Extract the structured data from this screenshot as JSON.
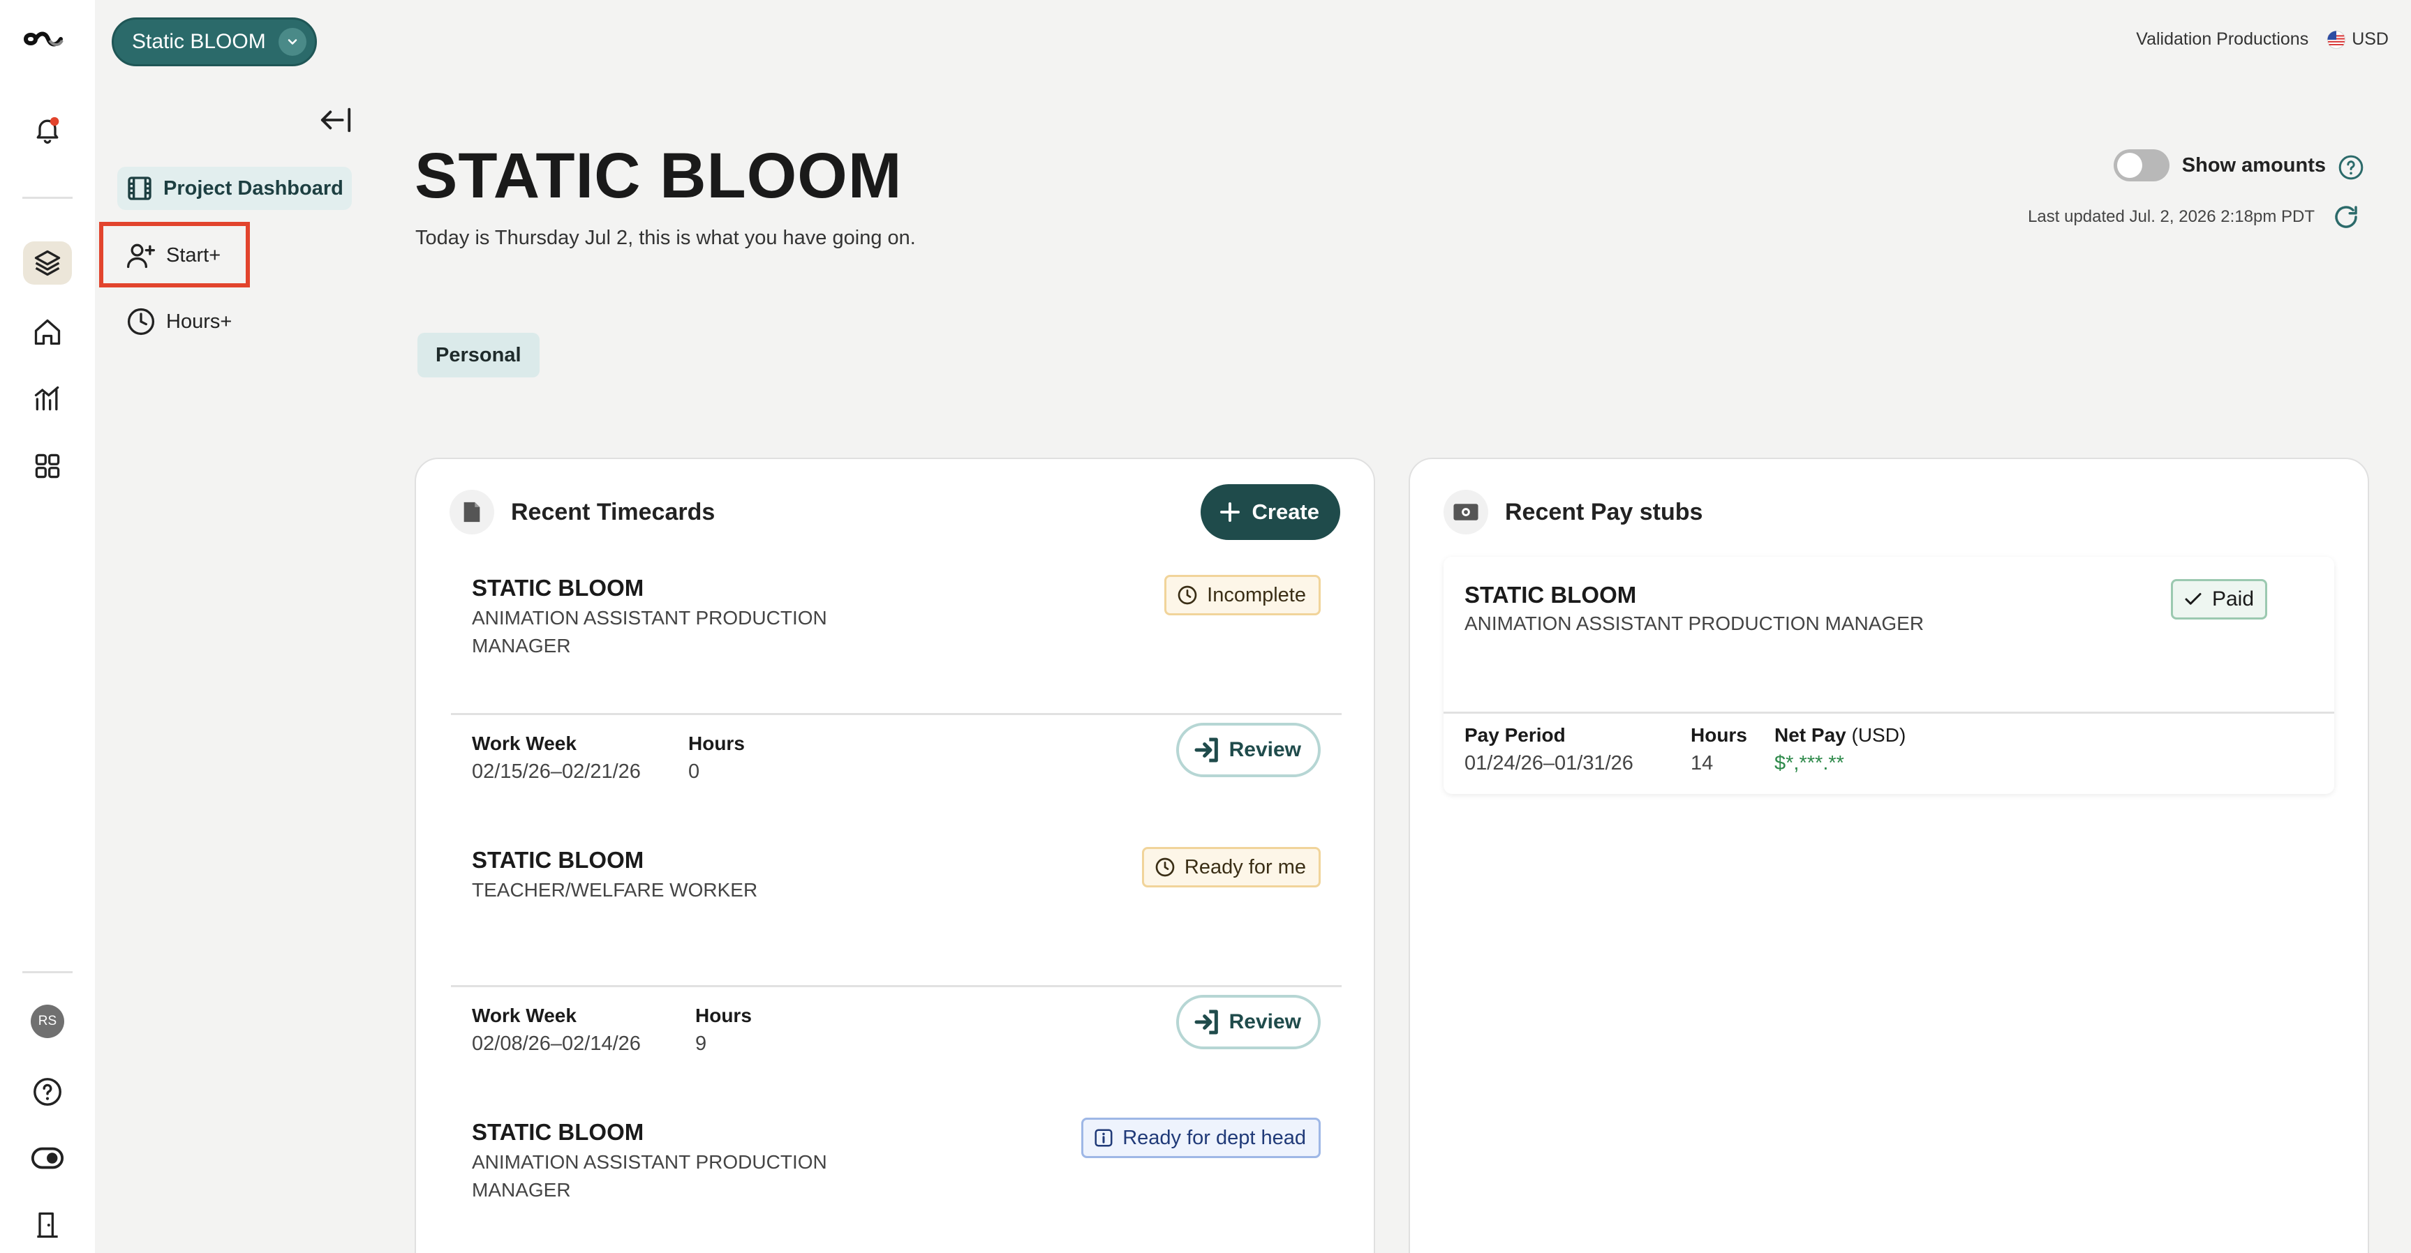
{
  "project_selector": {
    "label": "Static BLOOM"
  },
  "topbar": {
    "company": "Validation Productions",
    "currency": "USD"
  },
  "nav": {
    "items": [
      {
        "label": "Project Dashboard"
      },
      {
        "label": "Start+"
      },
      {
        "label": "Hours+"
      }
    ]
  },
  "rail": {
    "avatar_initials": "RS"
  },
  "header": {
    "title": "STATIC BLOOM",
    "subtitle": "Today is Thursday Jul 2, this is what you have going on.",
    "show_amounts_label": "Show amounts",
    "show_amounts_on": false,
    "last_updated": "Last updated Jul. 2, 2026 2:18pm PDT"
  },
  "filter_chip": "Personal",
  "timecards": {
    "title": "Recent Timecards",
    "create_label": "Create",
    "work_week_label": "Work Week",
    "hours_label": "Hours",
    "review_label": "Review",
    "items": [
      {
        "project": "STATIC BLOOM",
        "role": "ANIMATION ASSISTANT PRODUCTION MANAGER",
        "status": "Incomplete",
        "work_week": "02/15/26–02/21/26",
        "hours": "0"
      },
      {
        "project": "STATIC BLOOM",
        "role": "TEACHER/WELFARE WORKER",
        "status": "Ready for me",
        "work_week": "02/08/26–02/14/26",
        "hours": "9"
      },
      {
        "project": "STATIC BLOOM",
        "role": "ANIMATION ASSISTANT PRODUCTION MANAGER",
        "status": "Ready for dept head"
      }
    ]
  },
  "paystubs": {
    "title": "Recent Pay stubs",
    "items": [
      {
        "project": "STATIC BLOOM",
        "role": "ANIMATION ASSISTANT PRODUCTION MANAGER",
        "status": "Paid",
        "pay_period_label": "Pay Period",
        "pay_period": "01/24/26–01/31/26",
        "hours_label": "Hours",
        "hours": "14",
        "net_pay_label": "Net Pay",
        "net_pay_currency": "(USD)",
        "net_pay": "$*,***.**"
      }
    ]
  },
  "colors": {
    "brand_teal": "#2b6a6a",
    "dark_teal": "#1f4b4b",
    "highlight_red": "#e2442d",
    "money_green": "#2f8a4b"
  }
}
